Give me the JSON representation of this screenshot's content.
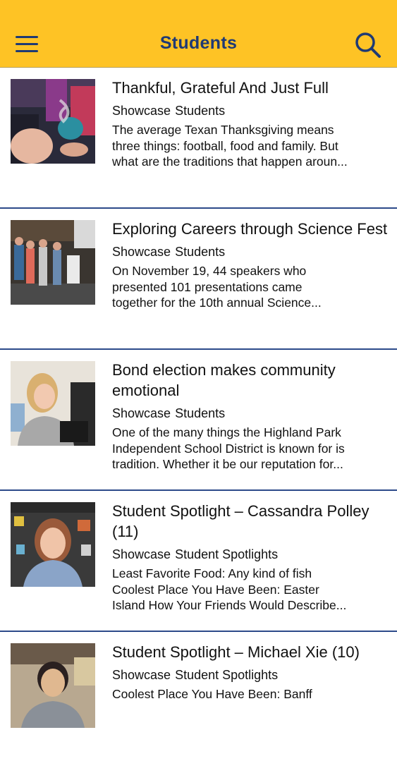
{
  "header": {
    "title": "Students",
    "background": "#fec325",
    "accent": "#1f3a74",
    "menu_icon": "hamburger-menu-icon",
    "search_icon": "search-icon"
  },
  "articles": [
    {
      "title": "Thankful, Grateful And Just Full",
      "categories": [
        "Showcase",
        "Students"
      ],
      "excerpt_lines": [
        "The average Texan Thanksgiving means",
        "three things: football, food and family. But",
        "what are the traditions that happen aroun..."
      ]
    },
    {
      "title": "Exploring Careers through Science Fest",
      "categories": [
        "Showcase",
        "Students"
      ],
      "excerpt_lines": [
        "On November 19, 44 speakers who",
        "presented 101 presentations came",
        "together for the 10th annual Science..."
      ]
    },
    {
      "title": "Bond election makes community emotional",
      "categories": [
        "Showcase",
        "Students"
      ],
      "excerpt_lines": [
        "One of the many things the Highland Park",
        "Independent School District is known for is",
        "tradition. Whether it be our reputation for..."
      ]
    },
    {
      "title": "Student Spotlight – Cassandra Polley (11)",
      "categories": [
        "Showcase",
        "Student Spotlights"
      ],
      "excerpt_lines": [
        "Least Favorite Food: Any kind of fish",
        "Coolest Place You Have Been: Easter",
        "Island How Your Friends Would Describe..."
      ]
    },
    {
      "title": "Student Spotlight – Michael Xie (10)",
      "categories": [
        "Showcase",
        "Student Spotlights"
      ],
      "excerpt_lines": [
        "Coolest Place You Have Been: Banff"
      ]
    }
  ]
}
